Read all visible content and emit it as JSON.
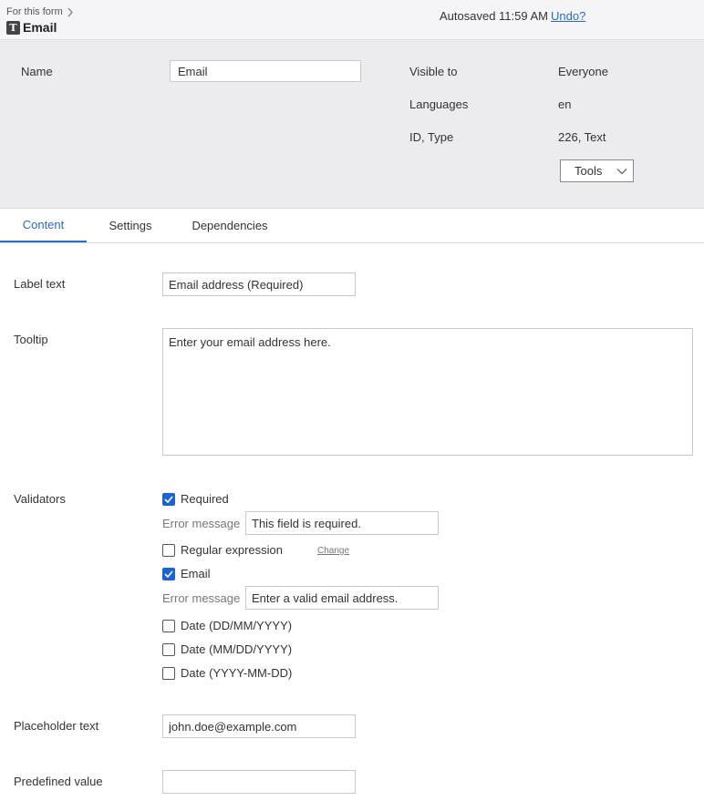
{
  "header": {
    "breadcrumb": "For this form",
    "title": "Email",
    "type_icon_letter": "T",
    "autosave_text": "Autosaved 11:59 AM",
    "undo_label": "Undo?"
  },
  "properties": {
    "name_label": "Name",
    "name_value": "Email",
    "visible_to_label": "Visible to",
    "visible_to_value": "Everyone",
    "languages_label": "Languages",
    "languages_value": "en",
    "id_type_label": "ID, Type",
    "id_type_value": "226, Text",
    "tools_label": "Tools"
  },
  "tabs": [
    {
      "label": "Content",
      "active": true
    },
    {
      "label": "Settings",
      "active": false
    },
    {
      "label": "Dependencies",
      "active": false
    }
  ],
  "content": {
    "label_text_label": "Label text",
    "label_text_value": "Email address (Required)",
    "tooltip_label": "Tooltip",
    "tooltip_value": "Enter your email address here.",
    "validators_label": "Validators",
    "validators": {
      "required_label": "Required",
      "required_checked": true,
      "required_error_label": "Error message",
      "required_error_value": "This field is required.",
      "regex_label": "Regular expression",
      "regex_checked": false,
      "regex_change_label": "Change",
      "email_label": "Email",
      "email_checked": true,
      "email_error_label": "Error message",
      "email_error_value": "Enter a valid email address.",
      "date_dmy_label": "Date (DD/MM/YYYY)",
      "date_dmy_checked": false,
      "date_mdy_label": "Date (MM/DD/YYYY)",
      "date_mdy_checked": false,
      "date_ymd_label": "Date (YYYY-MM-DD)",
      "date_ymd_checked": false
    },
    "placeholder_text_label": "Placeholder text",
    "placeholder_text_value": "john.doe@example.com",
    "predefined_value_label": "Predefined value",
    "predefined_value_value": ""
  },
  "colors": {
    "accent": "#2a6ac8",
    "checkbox_checked": "#1a62d6",
    "header_bg": "#f5f5f7",
    "properties_bg": "#ececee"
  }
}
